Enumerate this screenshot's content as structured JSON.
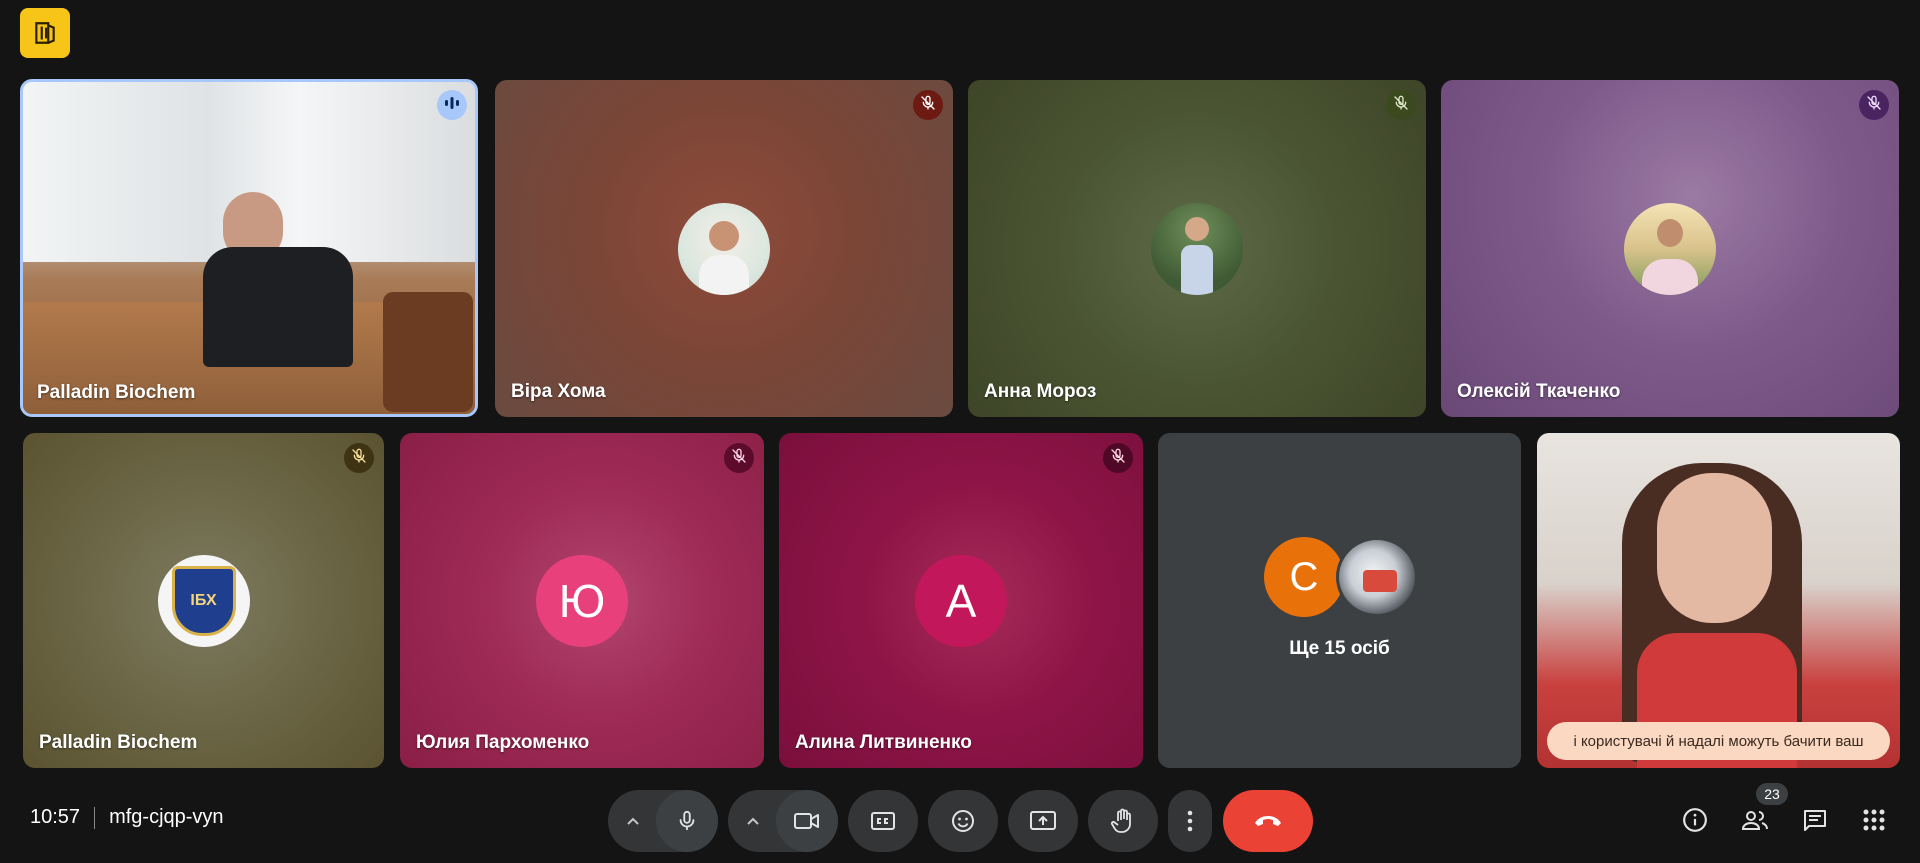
{
  "tiles": [
    {
      "name": "Palladin Biochem"
    },
    {
      "name": "Віра Хома"
    },
    {
      "name": "Анна Мороз"
    },
    {
      "name": "Олексій Ткаченко"
    },
    {
      "name": "Palladin Biochem"
    },
    {
      "name": "Юлия Пархоменко",
      "initial": "Ю"
    },
    {
      "name": "Алина Литвиненко",
      "initial": "А"
    }
  ],
  "others": {
    "initial": "C",
    "label": "Ще 15 осіб"
  },
  "caption": "і користувачі й надалі можуть бачити ваш",
  "meeting": {
    "time": "10:57",
    "code": "mfg-cjqp-vyn"
  },
  "participants_count": "23",
  "icons": {
    "speaking": "audio-bars-icon",
    "muted": "mic-off-icon",
    "mic": "mic-icon",
    "camera": "videocam-icon",
    "captions": "closed-captions-icon",
    "emoji": "emoji-icon",
    "present": "present-screen-icon",
    "hand": "raise-hand-icon",
    "more": "more-vert-icon",
    "leave": "call-end-icon",
    "info": "info-icon",
    "people": "people-icon",
    "chat": "chat-icon",
    "activities": "apps-grid-icon"
  },
  "colors": {
    "background": "#141414",
    "control": "#333537",
    "leave": "#ea4335",
    "logo": "#f7c518",
    "speaking_border": "#a8c7fa"
  }
}
